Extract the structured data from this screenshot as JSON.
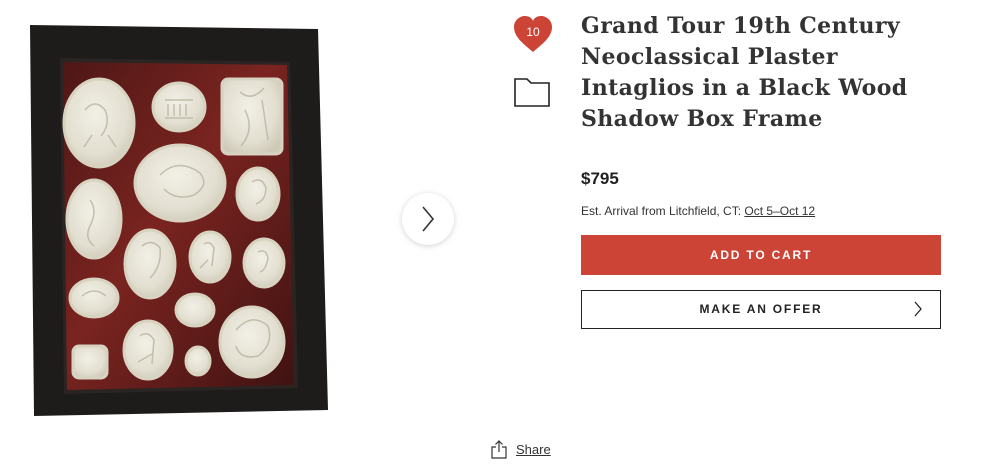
{
  "product": {
    "title": "Grand Tour 19th Century Neoclassical Plaster Intaglios in a Black Wood Shadow Box Frame",
    "price": "$795",
    "arrival_prefix": "Est. Arrival from Litchfield, CT: ",
    "arrival_dates": "Oct 5–Oct 12",
    "image_icon": "framed-intaglios-photo"
  },
  "favorite": {
    "count": "10",
    "icon": "heart-icon",
    "color": "#cc4435"
  },
  "folder": {
    "icon": "folder-icon"
  },
  "carousel": {
    "next_icon": "chevron-right-icon"
  },
  "actions": {
    "add_to_cart": "ADD TO CART",
    "make_offer": "MAKE AN OFFER",
    "make_offer_icon": "chevron-right-icon"
  },
  "share": {
    "label": "Share",
    "icon": "share-icon"
  },
  "colors": {
    "accent": "#cc4435",
    "frame": "#1e1c1b",
    "backing": "#6b1f1c",
    "plaster": "#e9e6da"
  }
}
